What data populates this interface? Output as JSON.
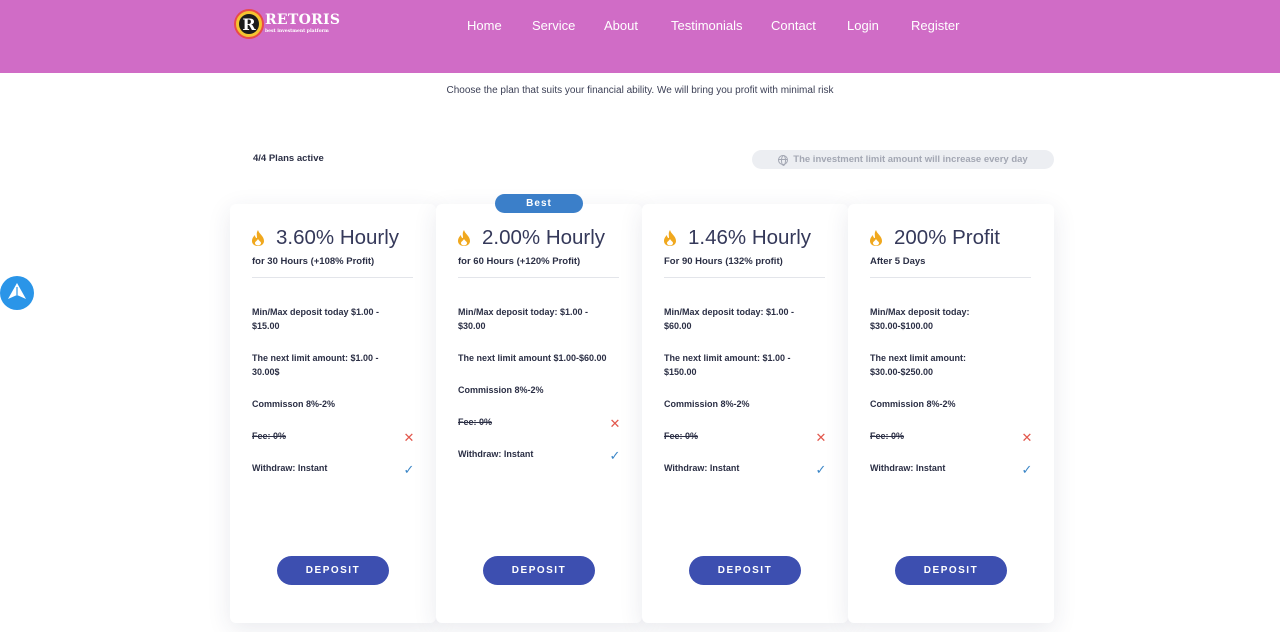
{
  "header": {
    "logo_letter": "R",
    "brand_name": "RETORIS",
    "brand_tagline": "best investment platform",
    "nav": [
      {
        "label": "Home"
      },
      {
        "label": "Service"
      },
      {
        "label": "About"
      },
      {
        "label": "Testimonials"
      },
      {
        "label": "Contact"
      },
      {
        "label": "Login"
      },
      {
        "label": "Register"
      }
    ]
  },
  "subtitle": "Choose the plan that suits your financial ability. We will bring you profit with minimal risk",
  "plans_active": "4/4 Plans active",
  "limit_notice": "The investment limit amount will increase every day",
  "best_badge": "Best",
  "colors": {
    "header_bg": "#d06cc6",
    "button": "#3d4fb0",
    "badge": "#3b7fc9",
    "flame": "#f0a81e",
    "cross": "#e2574c",
    "check": "#3b86c7"
  },
  "plans": [
    {
      "title": "3.60% Hourly",
      "subtitle": "for 30 Hours (+108% Profit)",
      "deposit_limits": "Min/Max deposit today $1.00 - $15.00",
      "next_limit": "The next limit amount: $1.00 - 30.00$",
      "commission": "Commisson 8%-2%",
      "fee": "Fee: 0%",
      "withdraw": "Withdraw: Instant",
      "button": "DEPOSIT"
    },
    {
      "title": "2.00% Hourly",
      "subtitle": "for 60 Hours (+120% Profit)",
      "deposit_limits": "Min/Max deposit today: $1.00 - $30.00",
      "next_limit": "The next limit amount $1.00-$60.00",
      "commission": "Commission 8%-2%",
      "fee": "Fee: 0%",
      "withdraw": "Withdraw: Instant",
      "button": "DEPOSIT"
    },
    {
      "title": "1.46% Hourly",
      "subtitle": "For 90 Hours (132% profit)",
      "deposit_limits": "Min/Max deposit today: $1.00 - $60.00",
      "next_limit": "The next limit amount: $1.00 - $150.00",
      "commission": "Commission 8%-2%",
      "fee": "Fee: 0%",
      "withdraw": "Withdraw: Instant",
      "button": "DEPOSIT"
    },
    {
      "title": "200% Profit",
      "subtitle": "After 5 Days",
      "deposit_limits": "Min/Max deposit today: $30.00-$100.00",
      "next_limit": "The next limit amount: $30.00-$250.00",
      "commission": "Commission 8%-2%",
      "fee": "Fee: 0%",
      "withdraw": "Withdraw: Instant",
      "button": "DEPOSIT"
    }
  ],
  "icons": {
    "plan": "flame-icon",
    "fee_status": "cross-icon",
    "withdraw_status": "check-icon",
    "notice": "globe-icon",
    "floating": "paper-plane-icon"
  }
}
